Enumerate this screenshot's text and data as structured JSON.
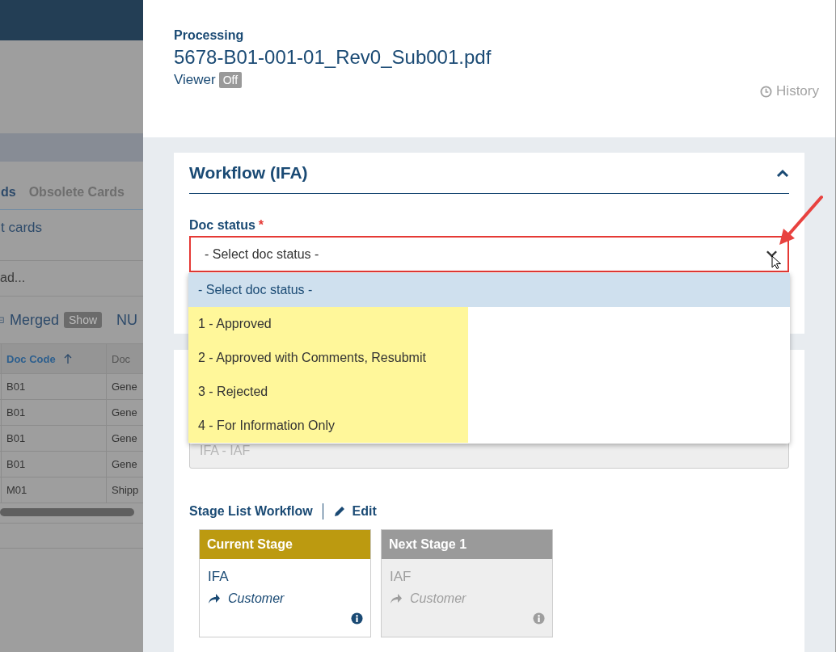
{
  "background_app": {
    "tabs": [
      {
        "label": "ds",
        "selected": true
      },
      {
        "label": "Obsolete Cards",
        "selected": false
      }
    ],
    "subtitle": "t cards",
    "search_text": "ad...",
    "merged": {
      "label": "Merged",
      "badge": "Show"
    },
    "column_3": "NU",
    "table": {
      "columns": [
        {
          "label": "Doc Code",
          "sorted": true
        },
        {
          "label": "Doc",
          "sorted": false
        }
      ],
      "rows": [
        [
          "B01",
          "Gene"
        ],
        [
          "B01",
          "Gene"
        ],
        [
          "B01",
          "Gene"
        ],
        [
          "B01",
          "Gene"
        ],
        [
          "M01",
          "Shipp"
        ]
      ]
    }
  },
  "panel": {
    "status": "Processing",
    "filename": "5678-B01-001-01_Rev0_Sub001.pdf",
    "viewer": {
      "label": "Viewer",
      "toggle": "Off",
      "on": false
    },
    "history": "History",
    "workflow": {
      "title": "Workflow (IFA)",
      "expanded": true,
      "doc_status": {
        "label": "Doc status",
        "required_mark": "*",
        "value": "- Select doc status -",
        "open": true,
        "options": [
          {
            "label": "- Select doc status -",
            "selected": true,
            "highlighted": false
          },
          {
            "label": "1 - Approved",
            "selected": false,
            "highlighted": true
          },
          {
            "label": "2 - Approved with Comments, Resubmit",
            "selected": false,
            "highlighted": true
          },
          {
            "label": "3 - Rejected",
            "selected": false,
            "highlighted": true
          },
          {
            "label": "4 - For Information Only",
            "selected": false,
            "highlighted": true
          }
        ]
      },
      "route_select": {
        "value": "IFA - IAF",
        "disabled": true
      },
      "stage_list": {
        "title": "Stage List Workflow",
        "edit": "Edit",
        "stages": [
          {
            "kind": "current",
            "header": "Current Stage",
            "name": "IFA",
            "assignee": "Customer"
          },
          {
            "kind": "next",
            "header": "Next Stage 1",
            "name": "IAF",
            "assignee": "Customer"
          }
        ]
      }
    }
  }
}
